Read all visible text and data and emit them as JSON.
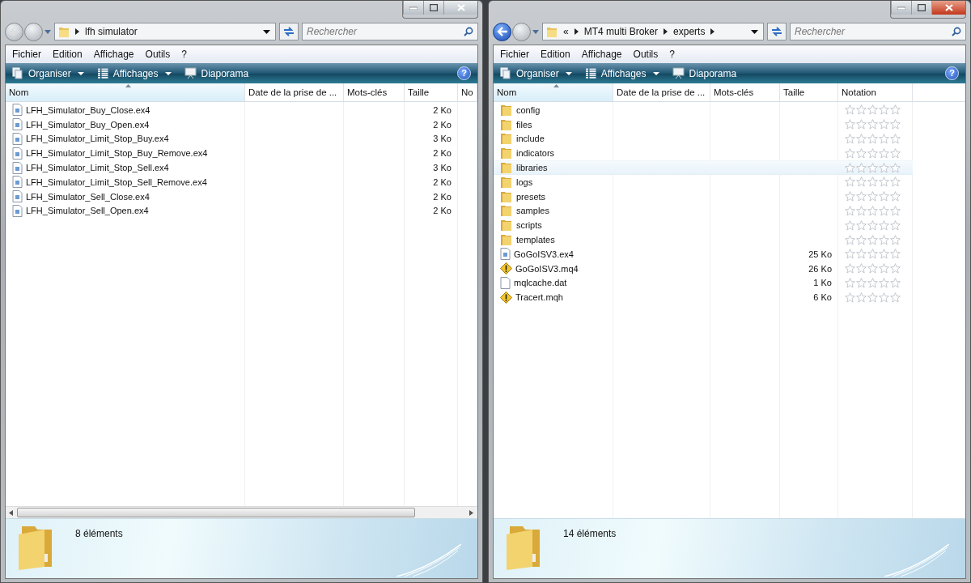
{
  "windows": [
    {
      "kind": "plain",
      "active": false,
      "back_enabled": false,
      "crumbs": [
        "lfh simulator"
      ],
      "search": {
        "placeholder": "Rechercher"
      },
      "menu": [
        "Fichier",
        "Edition",
        "Affichage",
        "Outils",
        "?"
      ],
      "toolbar": [
        {
          "label": "Organiser",
          "kind": "organize"
        },
        {
          "label": "Affichages",
          "kind": "views"
        },
        {
          "label": "Diaporama",
          "kind": "slideshow"
        }
      ],
      "help": "?",
      "columns": [
        {
          "label": "Nom",
          "sorted": true
        },
        {
          "label": "Date de la prise de ...",
          "sorted": false
        },
        {
          "label": "Mots-clés",
          "sorted": false
        },
        {
          "label": "Taille",
          "sorted": false
        },
        {
          "label": "No",
          "sorted": false
        }
      ],
      "hscroll": true,
      "rows": [
        {
          "kind": "exe",
          "name": "LFH_Simulator_Buy_Close.ex4",
          "size": "2 Ko",
          "highlighted": false
        },
        {
          "kind": "exe",
          "name": "LFH_Simulator_Buy_Open.ex4",
          "size": "2 Ko",
          "highlighted": false
        },
        {
          "kind": "exe",
          "name": "LFH_Simulator_Limit_Stop_Buy.ex4",
          "size": "3 Ko",
          "highlighted": false
        },
        {
          "kind": "exe",
          "name": "LFH_Simulator_Limit_Stop_Buy_Remove.ex4",
          "size": "2 Ko",
          "highlighted": false
        },
        {
          "kind": "exe",
          "name": "LFH_Simulator_Limit_Stop_Sell.ex4",
          "size": "3 Ko",
          "highlighted": false
        },
        {
          "kind": "exe",
          "name": "LFH_Simulator_Limit_Stop_Sell_Remove.ex4",
          "size": "2 Ko",
          "highlighted": false
        },
        {
          "kind": "exe",
          "name": "LFH_Simulator_Sell_Close.ex4",
          "size": "2 Ko",
          "highlighted": false
        },
        {
          "kind": "exe",
          "name": "LFH_Simulator_Sell_Open.ex4",
          "size": "2 Ko",
          "highlighted": false
        }
      ],
      "status": "8 éléments"
    },
    {
      "kind": "ratings",
      "active": true,
      "back_enabled": true,
      "overflow_mark": "«",
      "crumbs": [
        "MT4 multi Broker",
        "experts"
      ],
      "search": {
        "placeholder": "Rechercher"
      },
      "menu": [
        "Fichier",
        "Edition",
        "Affichage",
        "Outils",
        "?"
      ],
      "toolbar": [
        {
          "label": "Organiser",
          "kind": "organize"
        },
        {
          "label": "Affichages",
          "kind": "views"
        },
        {
          "label": "Diaporama",
          "kind": "slideshow"
        }
      ],
      "help": "?",
      "columns": [
        {
          "label": "Nom",
          "sorted": true
        },
        {
          "label": "Date de la prise de ...",
          "sorted": false
        },
        {
          "label": "Mots-clés",
          "sorted": false
        },
        {
          "label": "Taille",
          "sorted": false
        },
        {
          "label": "Notation",
          "sorted": false
        }
      ],
      "rows": [
        {
          "kind": "folder",
          "name": "config",
          "stars": 0,
          "highlighted": false
        },
        {
          "kind": "folder",
          "name": "files",
          "stars": 0,
          "highlighted": false
        },
        {
          "kind": "folder",
          "name": "include",
          "stars": 0,
          "highlighted": false
        },
        {
          "kind": "folder",
          "name": "indicators",
          "stars": 0,
          "highlighted": false
        },
        {
          "kind": "folder",
          "name": "libraries",
          "stars": 0,
          "highlighted": true
        },
        {
          "kind": "folder",
          "name": "logs",
          "stars": 0,
          "highlighted": false
        },
        {
          "kind": "folder",
          "name": "presets",
          "stars": 0,
          "highlighted": false
        },
        {
          "kind": "folder",
          "name": "samples",
          "stars": 0,
          "highlighted": false
        },
        {
          "kind": "folder",
          "name": "scripts",
          "stars": 0,
          "highlighted": false
        },
        {
          "kind": "folder",
          "name": "templates",
          "stars": 0,
          "highlighted": false
        },
        {
          "kind": "exe",
          "name": "GoGoISV3.ex4",
          "size": "25 Ko",
          "stars": 0,
          "highlighted": false
        },
        {
          "kind": "warning",
          "name": "GoGoISV3.mq4",
          "size": "26 Ko",
          "stars": 0,
          "highlighted": false
        },
        {
          "kind": "blank",
          "name": "mqlcache.dat",
          "size": "1 Ko",
          "stars": 0,
          "highlighted": false
        },
        {
          "kind": "warning",
          "name": "Tracert.mqh",
          "size": "6 Ko",
          "stars": 0,
          "highlighted": false
        }
      ],
      "status": "14 éléments"
    }
  ]
}
